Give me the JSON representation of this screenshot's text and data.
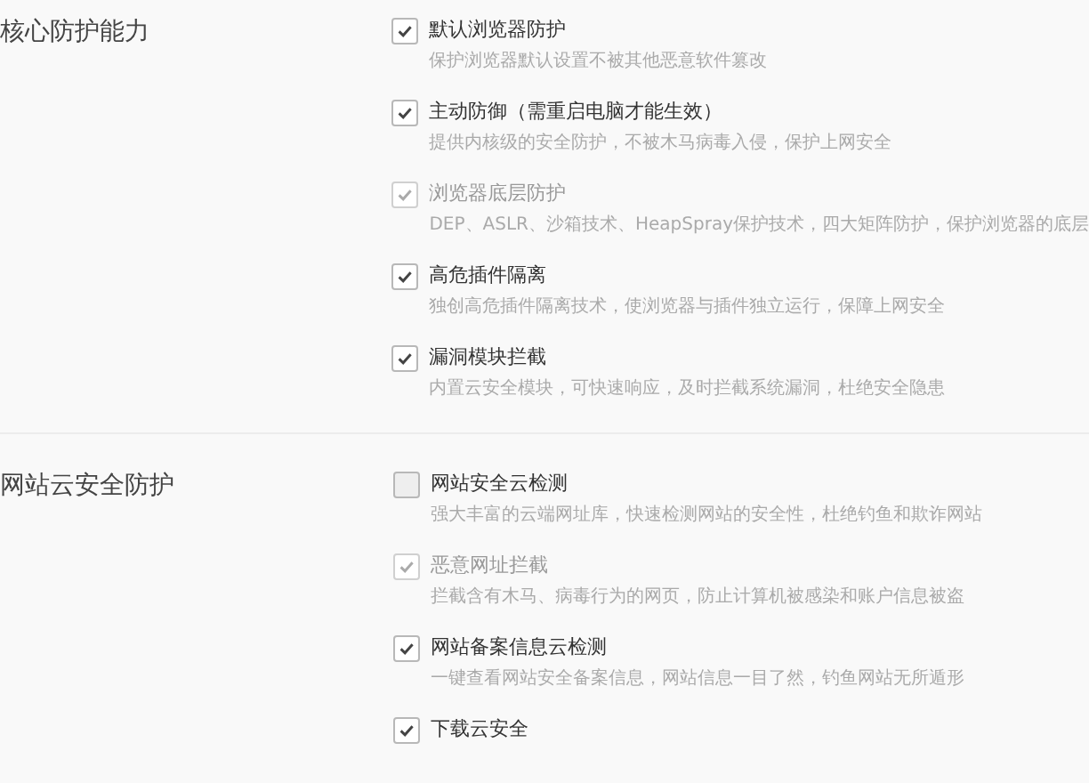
{
  "sections": [
    {
      "title": "核心防护能力",
      "options": [
        {
          "label": "默认浏览器防护",
          "description": "保护浏览器默认设置不被其他恶意软件篡改",
          "checked": true,
          "disabled": false
        },
        {
          "label": "主动防御（需重启电脑才能生效）",
          "description": "提供内核级的安全防护，不被木马病毒入侵，保护上网安全",
          "checked": true,
          "disabled": false
        },
        {
          "label": "浏览器底层防护",
          "description": "DEP、ASLR、沙箱技术、HeapSpray保护技术，四大矩阵防护，保护浏览器的底层",
          "checked": true,
          "disabled": true
        },
        {
          "label": "高危插件隔离",
          "description": "独创高危插件隔离技术，使浏览器与插件独立运行，保障上网安全",
          "checked": true,
          "disabled": false
        },
        {
          "label": "漏洞模块拦截",
          "description": "内置云安全模块，可快速响应，及时拦截系统漏洞，杜绝安全隐患",
          "checked": true,
          "disabled": false
        }
      ]
    },
    {
      "title": "网站云安全防护",
      "options": [
        {
          "label": "网站安全云检测",
          "description": "强大丰富的云端网址库，快速检测网站的安全性，杜绝钓鱼和欺诈网站",
          "checked": false,
          "disabled": false
        },
        {
          "label": "恶意网址拦截",
          "description": "拦截含有木马、病毒行为的网页，防止计算机被感染和账户信息被盗",
          "checked": true,
          "disabled": true
        },
        {
          "label": "网站备案信息云检测",
          "description": "一键查看网站安全备案信息，网站信息一目了然，钓鱼网站无所遁形",
          "checked": true,
          "disabled": false
        },
        {
          "label": "下载云安全",
          "checked": true,
          "disabled": false
        }
      ]
    }
  ]
}
